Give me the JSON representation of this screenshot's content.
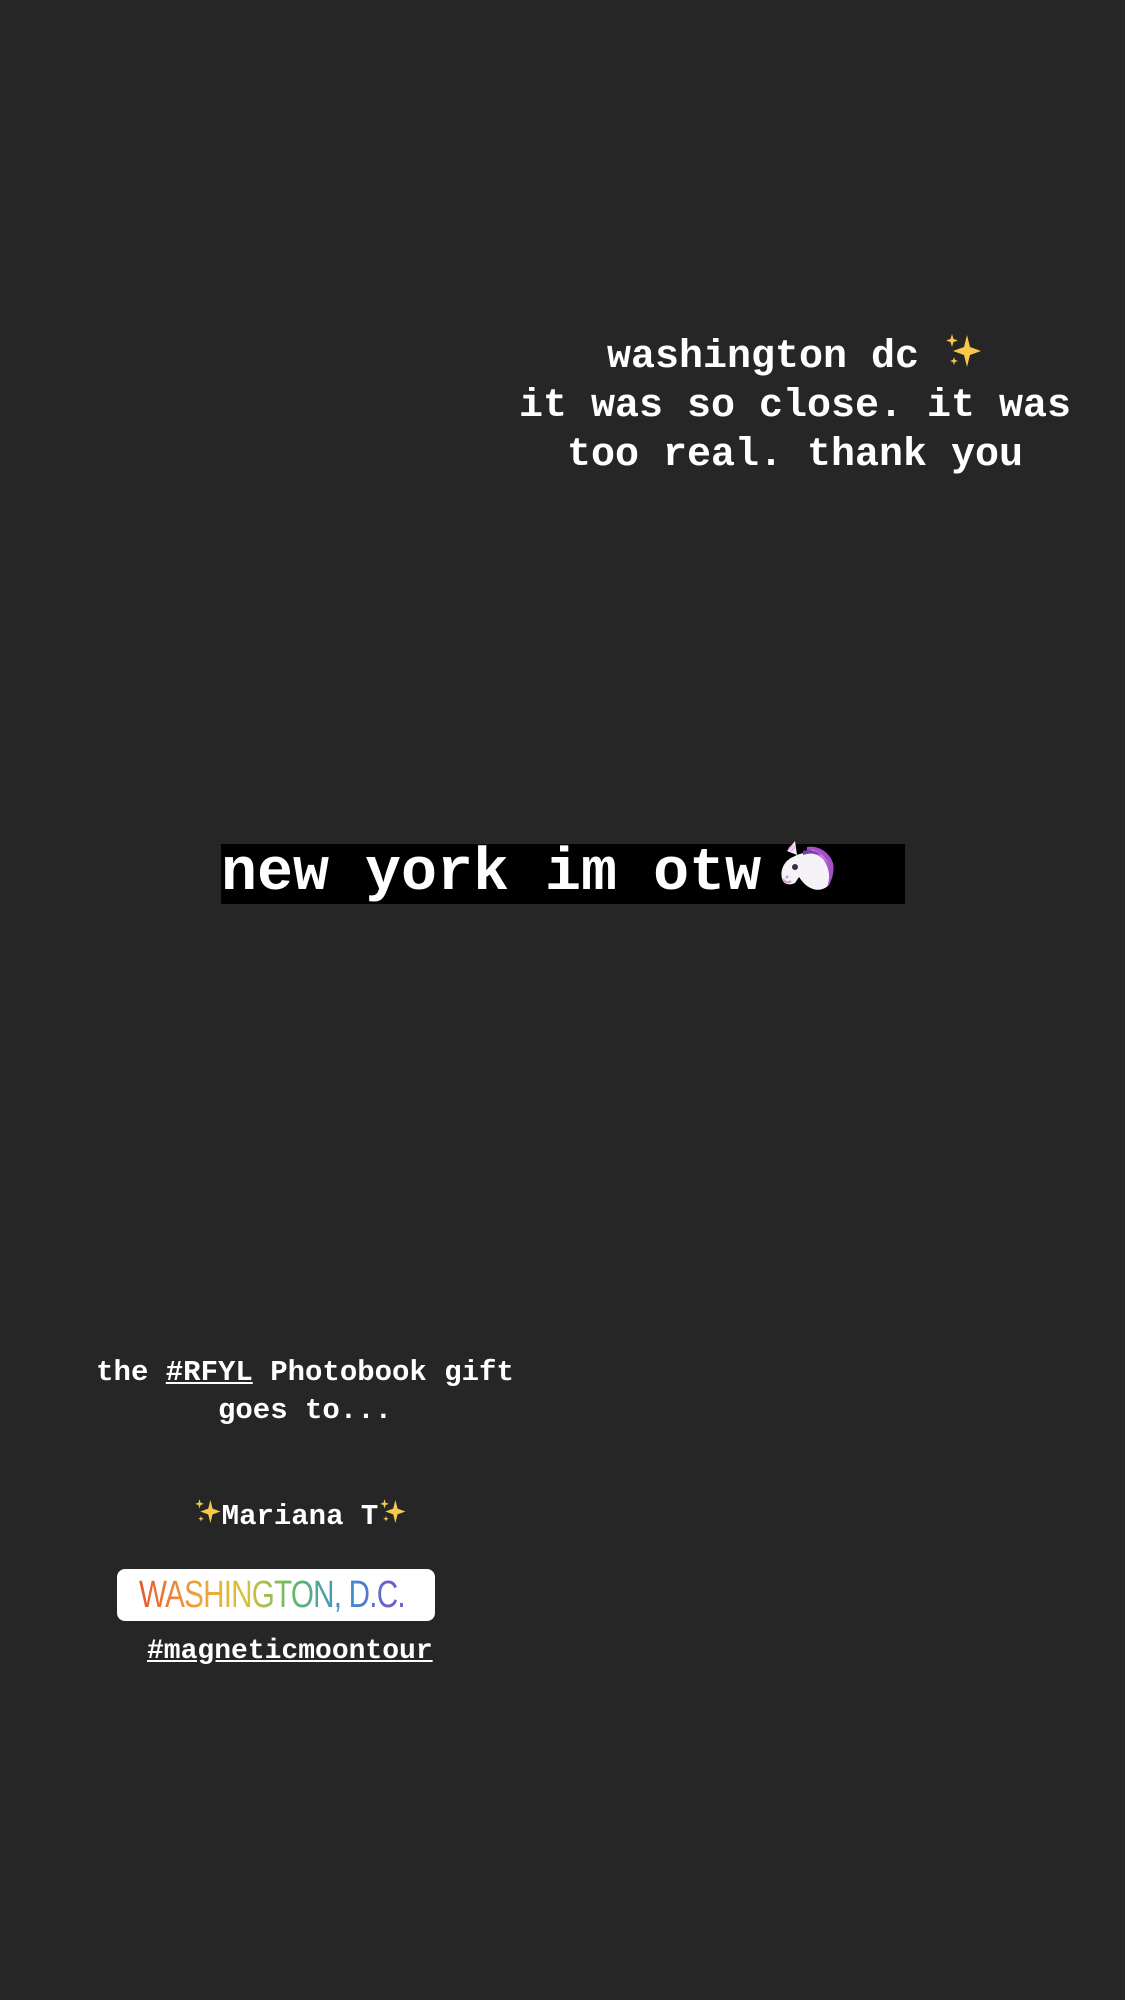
{
  "story": {
    "caption_top": {
      "line1": "washington dc",
      "line2": "it was so close. it was",
      "line3": "too real. thank you"
    },
    "banner": {
      "text": "new york im otw"
    },
    "gift_caption": {
      "prefix": "the",
      "hashtag": "#RFYL",
      "suffix": "Photobook gift",
      "line2": "goes to..."
    },
    "winner": {
      "name": "Mariana T"
    },
    "location_sticker": {
      "label": "WASHINGTON, D.C."
    },
    "tour_hashtag": "#magneticmoontour"
  },
  "icons": {
    "sparkles": "sparkles-emoji",
    "unicorn": "unicorn-emoji",
    "location_pin": "location-pin-icon"
  },
  "colors": {
    "background": "#262626",
    "text": "#ffffff",
    "banner_bg": "#000000",
    "sticker_bg": "#ffffff",
    "pin": "#e8572e"
  }
}
